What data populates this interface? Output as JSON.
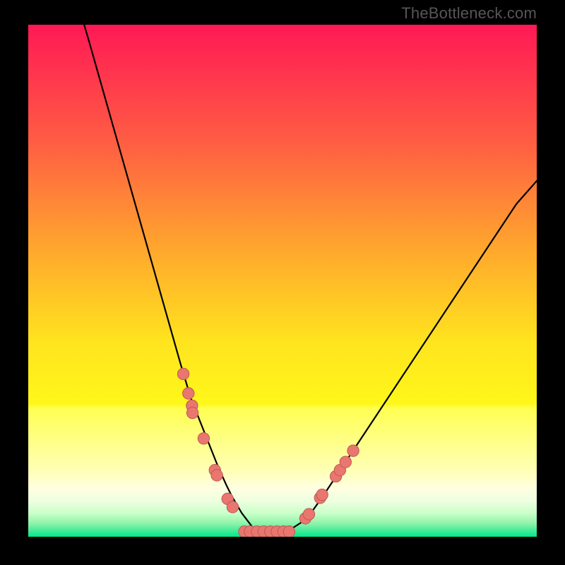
{
  "watermark": "TheBottleneck.com",
  "colors": {
    "gradient_top": "#ff1955",
    "gradient_mid1": "#ff7d3a",
    "gradient_mid2": "#ffd223",
    "gradient_mid3": "#fff71a",
    "gradient_mid4": "#ffffa8",
    "gradient_bottom_pale": "#d3ffc7",
    "gradient_bottom": "#00e98b",
    "curve": "#000000",
    "dot_fill": "#e9766f",
    "dot_stroke": "#bc5b56",
    "frame": "#000000"
  },
  "chart_data": {
    "type": "line",
    "title": "",
    "xlabel": "",
    "ylabel": "",
    "xlim": [
      0,
      100
    ],
    "ylim": [
      0,
      100
    ],
    "curve_x": [
      11,
      12,
      14,
      16,
      18,
      20,
      22,
      24,
      26,
      28,
      30,
      32,
      34,
      36,
      37,
      38,
      39,
      40,
      41,
      42,
      43,
      44,
      45,
      46,
      48,
      50,
      52,
      54,
      56,
      58,
      60,
      64,
      68,
      72,
      76,
      80,
      84,
      88,
      92,
      96,
      100
    ],
    "curve_y": [
      100,
      96.6,
      89.6,
      82.6,
      75.6,
      68.6,
      61.6,
      54.6,
      47.6,
      40.6,
      33.6,
      27,
      22,
      17,
      14.5,
      12.2,
      10,
      8,
      6.3,
      4.6,
      3.3,
      2,
      1.2,
      1,
      1,
      1,
      1.7,
      3,
      5.2,
      8,
      11,
      17,
      23,
      29,
      35,
      41,
      47,
      53,
      59,
      65,
      69.5
    ],
    "series": [
      {
        "name": "left-dots",
        "x": [
          30.5,
          31.5,
          32.2,
          32.3,
          34.5,
          36.7,
          37.1,
          39.2,
          40.2
        ],
        "y": [
          31.8,
          28.0,
          25.6,
          24.2,
          19.2,
          13.0,
          12.0,
          7.4,
          5.8
        ]
      },
      {
        "name": "valley-dots",
        "x": [
          42.5,
          43.6,
          45.0,
          46.3,
          47.6,
          48.9,
          50.2,
          51.3
        ],
        "y": [
          1.0,
          1.0,
          1.0,
          1.0,
          1.0,
          1.0,
          1.0,
          1.0
        ]
      },
      {
        "name": "right-dots",
        "x": [
          54.5,
          55.2,
          57.4,
          57.8,
          60.5,
          61.3,
          62.4,
          63.9
        ],
        "y": [
          3.6,
          4.4,
          7.6,
          8.2,
          11.8,
          13.0,
          14.6,
          16.8
        ]
      }
    ]
  }
}
